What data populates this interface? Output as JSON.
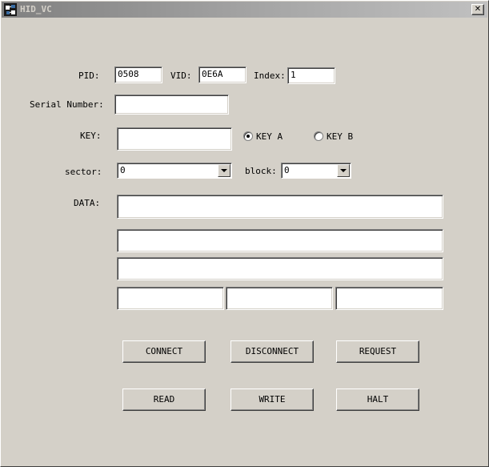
{
  "window": {
    "title": "HID_VC",
    "close_glyph": "✕"
  },
  "form": {
    "pid": {
      "label": "PID:",
      "value": "0508"
    },
    "vid": {
      "label": "VID:",
      "value": "0E6A"
    },
    "index": {
      "label": "Index:",
      "value": "1"
    },
    "serial": {
      "label": "Serial Number:",
      "value": ""
    },
    "key": {
      "label": "KEY:",
      "value": ""
    },
    "key_a": {
      "label": "KEY A",
      "checked": true
    },
    "key_b": {
      "label": "KEY B",
      "checked": false
    },
    "sector": {
      "label": "sector:",
      "value": "0"
    },
    "block": {
      "label": "block:",
      "value": "0"
    },
    "data": {
      "label": "DATA:"
    }
  },
  "buttons": {
    "connect": "CONNECT",
    "disconnect": "DISCONNECT",
    "request": "REQUEST",
    "read": "READ",
    "write": "WRITE",
    "halt": "HALT"
  }
}
